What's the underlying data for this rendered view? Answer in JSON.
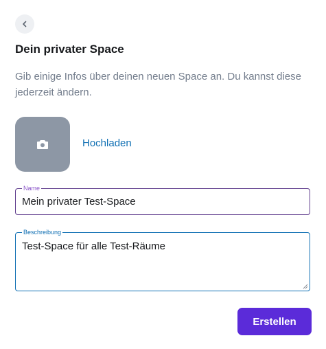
{
  "header": {
    "back_icon": "chevron-left-icon",
    "title": "Dein privater Space",
    "description": "Gib einige Infos über deinen neuen Space an. Du kannst diese jederzeit ändern."
  },
  "avatar": {
    "icon": "camera-icon",
    "upload_label": "Hochladen"
  },
  "form": {
    "name": {
      "label": "Name",
      "value": "Mein privater Test-Space"
    },
    "description": {
      "label": "Beschreibung",
      "value": "Test-Space für alle Test-Räume"
    }
  },
  "actions": {
    "create_label": "Erstellen"
  },
  "colors": {
    "accent": "#5b2bd9",
    "link": "#0f6fb3",
    "avatar_bg": "#8d97a5",
    "focused_border": "#5e3b8c"
  }
}
